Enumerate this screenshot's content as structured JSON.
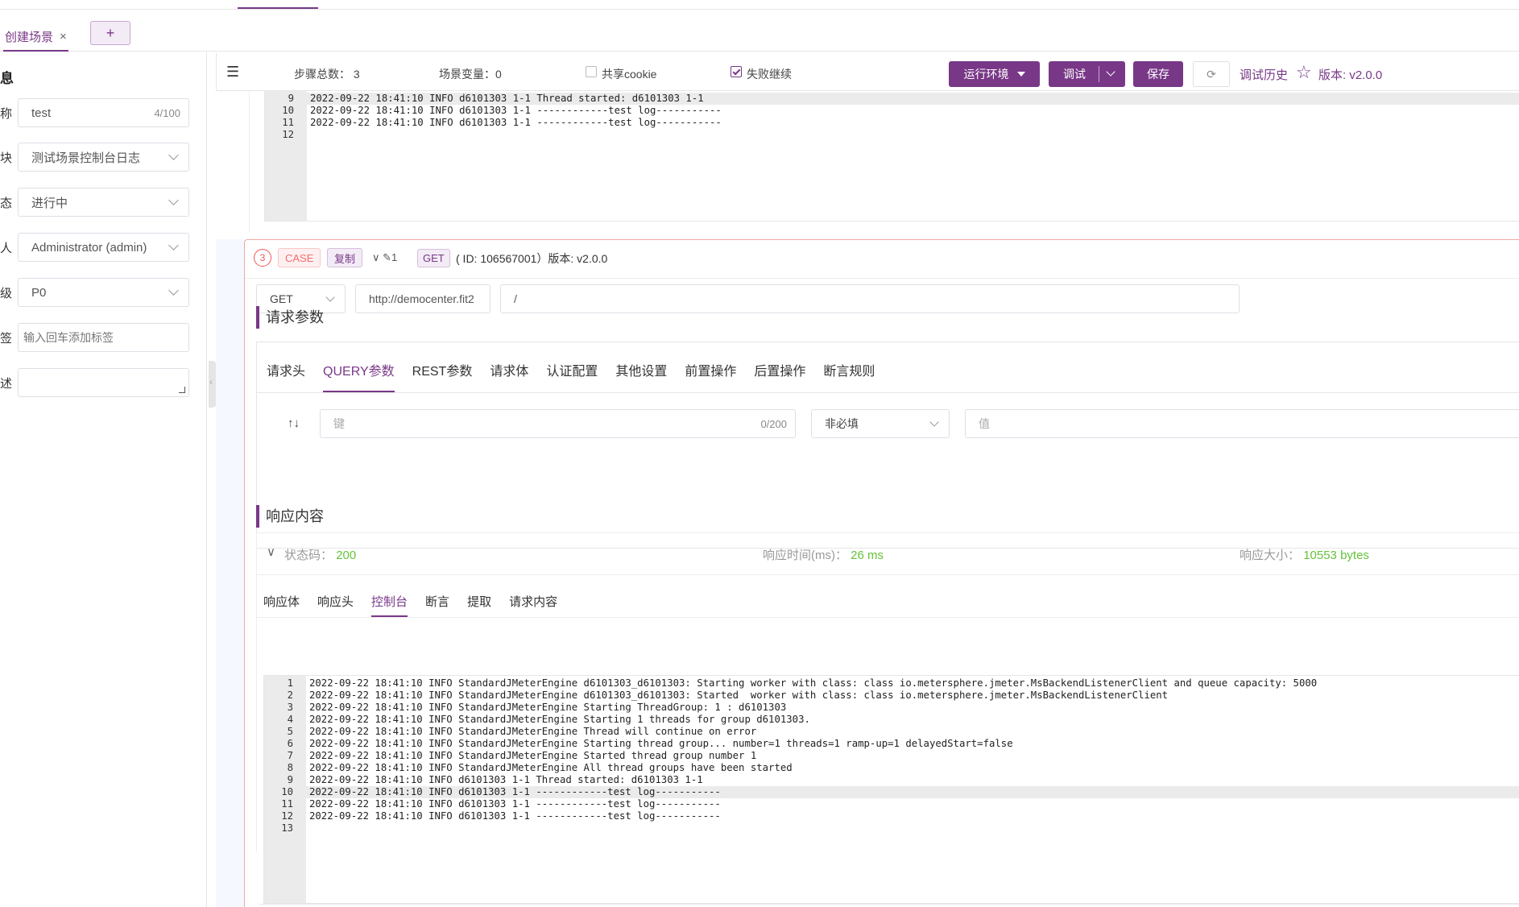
{
  "tabs": {
    "active_label": "创建场景",
    "close_glyph": "×",
    "add_glyph": "+"
  },
  "left_panel": {
    "title": "息",
    "labels": [
      "称",
      "块",
      "态",
      "人",
      "级",
      "签",
      "述"
    ],
    "name_value": "test",
    "name_count": "4/100",
    "module_value": "测试场景控制台日志",
    "status_value": "进行中",
    "owner_value": "Administrator (admin)",
    "level_value": "P0",
    "tag_placeholder": "输入回车添加标签",
    "desc_value": ""
  },
  "toolbar": {
    "step_count_label": "步骤总数：",
    "step_count_value": "3",
    "scene_var_label": "场景变量",
    "scene_var_value": "：0",
    "share_cookie_label": "共享cookie",
    "share_cookie_checked": false,
    "fail_continue_label": "失败继续",
    "fail_continue_checked": true,
    "run_env_label": "运行环境",
    "debug_label": "调试",
    "save_label": "保存",
    "debug_history_label": "调试历史",
    "version_label": "版本: v2.0.0"
  },
  "top_log": [
    {
      "ln": "9",
      "text": "2022-09-22 18:41:10 INFO d6101303 1-1 Thread started: d6101303 1-1"
    },
    {
      "ln": "10",
      "text": "2022-09-22 18:41:10 INFO d6101303 1-1 ------------test log-----------"
    },
    {
      "ln": "11",
      "text": "2022-09-22 18:41:10 INFO d6101303 1-1 ------------test log-----------"
    },
    {
      "ln": "12",
      "text": ""
    }
  ],
  "case": {
    "step_number": "3",
    "case_tag": "CASE",
    "copy_tag": "复制",
    "step_count": "1",
    "method_tag": "GET",
    "id_info": "( ID: 106567001）版本: v2.0.0",
    "method": "GET",
    "url": "http://democenter.fit2",
    "path": "/"
  },
  "request": {
    "section_title": "请求参数",
    "tabs": [
      "请求头",
      "QUERY参数",
      "REST参数",
      "请求体",
      "认证配置",
      "其他设置",
      "前置操作",
      "后置操作",
      "断言规则"
    ],
    "active_tab": "QUERY参数",
    "sort_glyph": "↑↓",
    "key_placeholder": "键",
    "key_count": "0/200",
    "required_value": "非必填",
    "value_placeholder": "值"
  },
  "response": {
    "section_title": "响应内容",
    "status_label": "状态码：",
    "status_value": "200",
    "time_label": "响应时间(ms)：",
    "time_value": "26 ms",
    "size_label": "响应大小：",
    "size_value": "10553 bytes",
    "tabs": [
      "响应体",
      "响应头",
      "控制台",
      "断言",
      "提取",
      "请求内容"
    ],
    "active_tab": "控制台"
  },
  "console_log": [
    {
      "ln": "1",
      "text": "2022-09-22 18:41:10 INFO StandardJMeterEngine d6101303_d6101303: Starting worker with class: class io.metersphere.jmeter.MsBackendListenerClient and queue capacity: 5000"
    },
    {
      "ln": "2",
      "text": "2022-09-22 18:41:10 INFO StandardJMeterEngine d6101303_d6101303: Started  worker with class: class io.metersphere.jmeter.MsBackendListenerClient"
    },
    {
      "ln": "3",
      "text": "2022-09-22 18:41:10 INFO StandardJMeterEngine Starting ThreadGroup: 1 : d6101303"
    },
    {
      "ln": "4",
      "text": "2022-09-22 18:41:10 INFO StandardJMeterEngine Starting 1 threads for group d6101303."
    },
    {
      "ln": "5",
      "text": "2022-09-22 18:41:10 INFO StandardJMeterEngine Thread will continue on error"
    },
    {
      "ln": "6",
      "text": "2022-09-22 18:41:10 INFO StandardJMeterEngine Starting thread group... number=1 threads=1 ramp-up=1 delayedStart=false"
    },
    {
      "ln": "7",
      "text": "2022-09-22 18:41:10 INFO StandardJMeterEngine Started thread group number 1"
    },
    {
      "ln": "8",
      "text": "2022-09-22 18:41:10 INFO StandardJMeterEngine All thread groups have been started"
    },
    {
      "ln": "9",
      "text": "2022-09-22 18:41:10 INFO d6101303 1-1 Thread started: d6101303 1-1"
    },
    {
      "ln": "10",
      "text": "2022-09-22 18:41:10 INFO d6101303 1-1 ------------test log-----------"
    },
    {
      "ln": "11",
      "text": "2022-09-22 18:41:10 INFO d6101303 1-1 ------------test log-----------"
    },
    {
      "ln": "12",
      "text": "2022-09-22 18:41:10 INFO d6101303 1-1 ------------test log-----------"
    },
    {
      "ln": "13",
      "text": ""
    }
  ],
  "colors": {
    "accent": "#783887",
    "success": "#67c23a",
    "danger": "#f56c6c"
  }
}
